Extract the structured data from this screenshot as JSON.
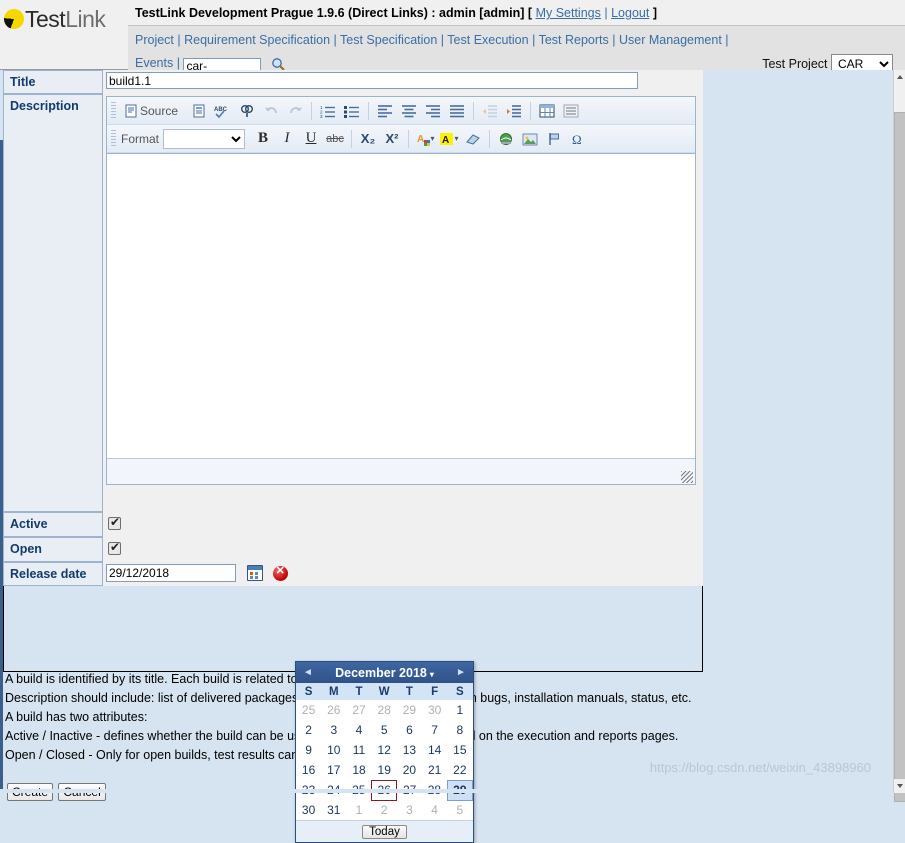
{
  "header": {
    "logo_text_1": "Test",
    "logo_text_2": "Link",
    "title_prefix": "TestLink Development Prague 1.9.6 (Direct Links) : admin [admin] [",
    "my_settings": "My Settings",
    "title_sep": "|",
    "logout": "Logout",
    "title_suffix": "]",
    "nav": {
      "project": "Project",
      "requirement_specification": "Requirement Specification",
      "test_specification": "Test Specification",
      "test_execution": "Test Execution",
      "test_reports": "Test Reports",
      "user_management": "User Management",
      "events": "Events",
      "separator": "|",
      "search_value": "car-",
      "search_placeholder": ""
    },
    "test_project_label": "Test Project",
    "test_project_value": "CAR",
    "test_project_options": [
      "CAR"
    ]
  },
  "form": {
    "title_label": "Title",
    "title_value": "build1.1",
    "description_label": "Description",
    "active_label": "Active",
    "active_checked": true,
    "open_label": "Open",
    "open_checked": true,
    "release_date_label": "Release date",
    "release_date_value": "29/12/2018",
    "description_value": ""
  },
  "editor": {
    "source_label": "Source",
    "format_label": "Format",
    "format_value": "",
    "format_options": [
      ""
    ],
    "toolbar_row1": [
      {
        "name": "source-button",
        "glyph": "☰"
      },
      {
        "name": "templates-icon",
        "glyph": "☷"
      },
      {
        "name": "spellcheck-icon",
        "glyph": "ABC"
      },
      {
        "name": "find-replace-icon",
        "glyph": "⌘"
      },
      {
        "name": "undo-icon",
        "glyph": "↶"
      },
      {
        "name": "redo-icon",
        "glyph": "↷"
      },
      {
        "name": "numbered-list-icon",
        "glyph": "≣"
      },
      {
        "name": "bulleted-list-icon",
        "glyph": "≡"
      },
      {
        "name": "align-left-icon",
        "glyph": "≡"
      },
      {
        "name": "align-center-icon",
        "glyph": "≡"
      },
      {
        "name": "align-right-icon",
        "glyph": "≡"
      },
      {
        "name": "align-justify-icon",
        "glyph": "≡"
      },
      {
        "name": "outdent-icon",
        "glyph": "≡"
      },
      {
        "name": "indent-icon",
        "glyph": "≡"
      },
      {
        "name": "table-icon",
        "glyph": "▦"
      },
      {
        "name": "horizontal-rule-icon",
        "glyph": "≡"
      }
    ],
    "toolbar_row2": [
      {
        "name": "bold-button",
        "glyph": "B"
      },
      {
        "name": "italic-button",
        "glyph": "I"
      },
      {
        "name": "underline-button",
        "glyph": "U"
      },
      {
        "name": "strikethrough-button",
        "glyph": "abc"
      },
      {
        "name": "subscript-button",
        "glyph": "X₂"
      },
      {
        "name": "superscript-button",
        "glyph": "X²"
      },
      {
        "name": "text-color-icon",
        "glyph": "A"
      },
      {
        "name": "background-color-icon",
        "glyph": "A"
      },
      {
        "name": "remove-format-icon",
        "glyph": "▱"
      },
      {
        "name": "link-icon",
        "glyph": "⊕"
      },
      {
        "name": "image-icon",
        "glyph": "⬚"
      },
      {
        "name": "flag-icon",
        "glyph": "⚑"
      },
      {
        "name": "special-char-icon",
        "glyph": "Ω"
      }
    ]
  },
  "calendar": {
    "prev_label": "◄",
    "next_label": "►",
    "month_title": "December 2018",
    "caret": "▾",
    "weekdays": [
      "S",
      "M",
      "T",
      "W",
      "T",
      "F",
      "S"
    ],
    "weeks": [
      [
        {
          "d": "25",
          "type": "other"
        },
        {
          "d": "26",
          "type": "other"
        },
        {
          "d": "27",
          "type": "other"
        },
        {
          "d": "28",
          "type": "other"
        },
        {
          "d": "29",
          "type": "other"
        },
        {
          "d": "30",
          "type": "other"
        },
        {
          "d": "1",
          "type": "cur"
        }
      ],
      [
        {
          "d": "2",
          "type": "cur"
        },
        {
          "d": "3",
          "type": "cur"
        },
        {
          "d": "4",
          "type": "cur"
        },
        {
          "d": "5",
          "type": "cur"
        },
        {
          "d": "6",
          "type": "cur"
        },
        {
          "d": "7",
          "type": "cur"
        },
        {
          "d": "8",
          "type": "cur"
        }
      ],
      [
        {
          "d": "9",
          "type": "cur"
        },
        {
          "d": "10",
          "type": "cur"
        },
        {
          "d": "11",
          "type": "cur"
        },
        {
          "d": "12",
          "type": "cur"
        },
        {
          "d": "13",
          "type": "cur"
        },
        {
          "d": "14",
          "type": "cur"
        },
        {
          "d": "15",
          "type": "cur"
        }
      ],
      [
        {
          "d": "16",
          "type": "cur"
        },
        {
          "d": "17",
          "type": "cur"
        },
        {
          "d": "18",
          "type": "cur"
        },
        {
          "d": "19",
          "type": "cur"
        },
        {
          "d": "20",
          "type": "cur"
        },
        {
          "d": "21",
          "type": "cur"
        },
        {
          "d": "22",
          "type": "cur"
        }
      ],
      [
        {
          "d": "23",
          "type": "cur"
        },
        {
          "d": "24",
          "type": "cur"
        },
        {
          "d": "25",
          "type": "cur"
        },
        {
          "d": "26",
          "type": "today"
        },
        {
          "d": "27",
          "type": "cur"
        },
        {
          "d": "28",
          "type": "cur"
        },
        {
          "d": "29",
          "type": "sel"
        }
      ],
      [
        {
          "d": "30",
          "type": "cur"
        },
        {
          "d": "31",
          "type": "cur"
        },
        {
          "d": "1",
          "type": "other"
        },
        {
          "d": "2",
          "type": "other"
        },
        {
          "d": "3",
          "type": "other"
        },
        {
          "d": "4",
          "type": "other"
        },
        {
          "d": "5",
          "type": "other"
        }
      ]
    ],
    "today_label": "Today"
  },
  "help": {
    "line1": "A build is identified by its title. Each build is related to a test plan.",
    "line2": "Description should include: list of delivered packages, new features, bug fixes, known bugs, installation manuals, status, etc.",
    "line3": "A build has two attributes:",
    "line4": "Active / Inactive - defines whether the build can be used. Inactive builds are not listed on the execution and reports pages.",
    "line5": "Open / Closed - Only for open builds, test results can be added or changed."
  },
  "buttons": {
    "create": "Create",
    "cancel": "Cancel"
  },
  "watermark": "https://blog.csdn.net/weixin_43898960"
}
